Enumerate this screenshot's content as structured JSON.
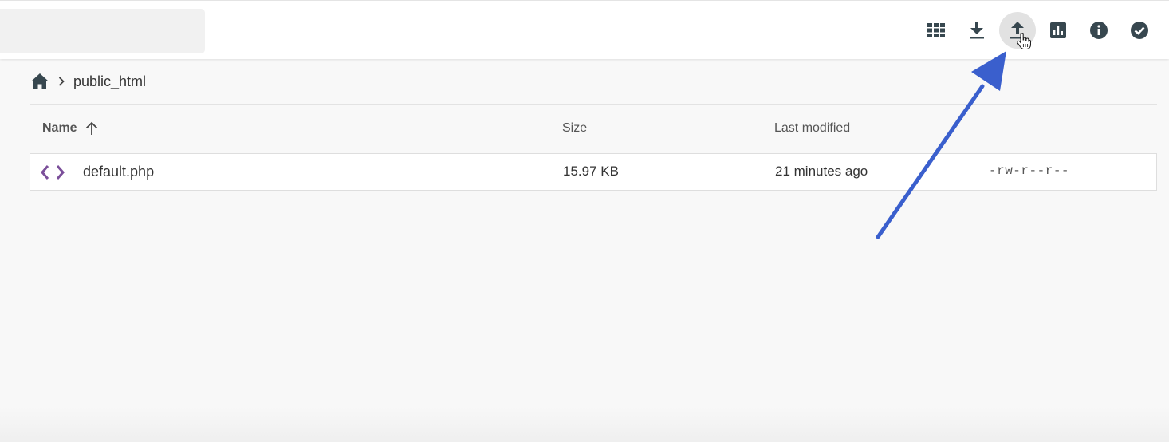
{
  "header": {
    "search": {
      "placeholder": ""
    },
    "toolbar": {
      "items": [
        {
          "name": "grid-view",
          "icon": "grid-icon"
        },
        {
          "name": "download",
          "icon": "download-icon"
        },
        {
          "name": "upload",
          "icon": "upload-icon",
          "active": true
        },
        {
          "name": "stats",
          "icon": "bar-chart-icon"
        },
        {
          "name": "info",
          "icon": "info-icon"
        },
        {
          "name": "select",
          "icon": "check-circle-icon"
        }
      ]
    }
  },
  "breadcrumb": {
    "home_icon": "home-icon",
    "separator_icon": "chevron-right-icon",
    "current": "public_html"
  },
  "table": {
    "columns": {
      "name": "Name",
      "size": "Size",
      "modified": "Last modified"
    },
    "sort_icon": "arrow-up-icon",
    "rows": [
      {
        "icon": "code-icon",
        "name": "default.php",
        "size": "15.97 KB",
        "modified": "21 minutes ago",
        "permissions": "-rw-r--r--"
      }
    ]
  },
  "colors": {
    "icon_dark": "#37474f",
    "code_icon": "#7b4f9a",
    "arrow": "#3a5fcd",
    "active_button_bg": "#e2e2e2"
  }
}
